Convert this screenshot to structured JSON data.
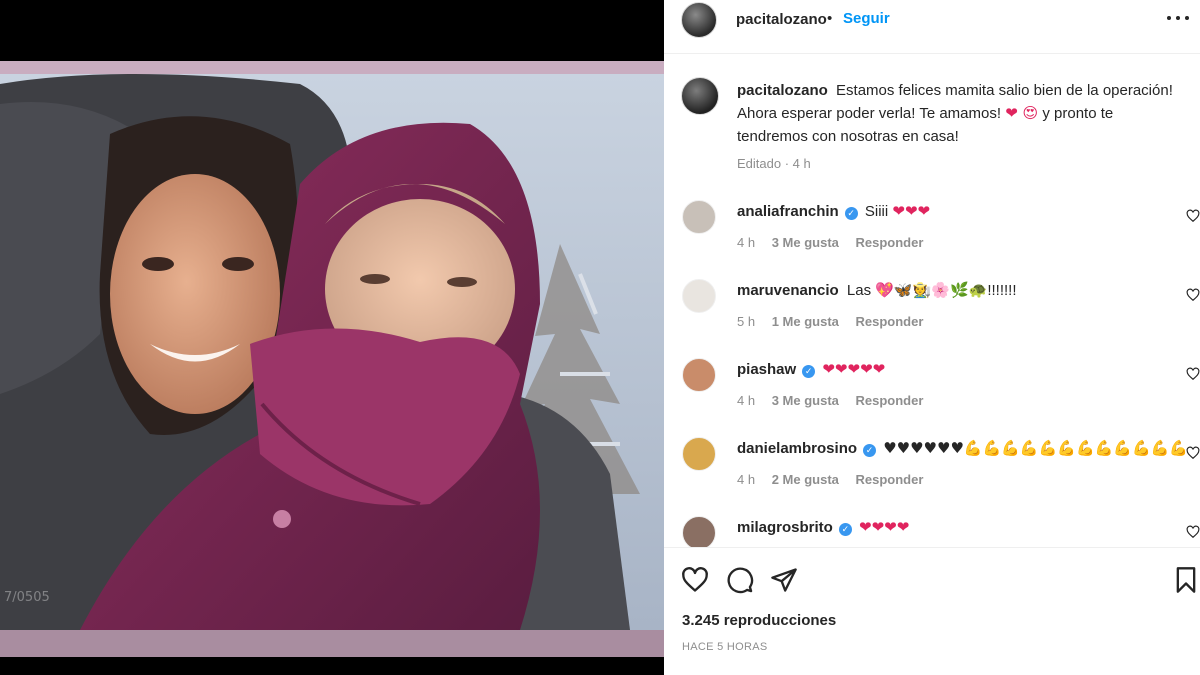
{
  "media": {
    "watermark": "7/0505"
  },
  "header": {
    "username": "pacitalozano",
    "separator": "•",
    "follow_label": "Seguir"
  },
  "caption": {
    "username": "pacitalozano",
    "text_before_emoji": "Estamos felices mamita salio bien de la operación! Ahora esperar poder verla! Te amamos!",
    "emoji": "❤ 😍",
    "text_after_emoji": "y pronto te tendremos con nosotras en casa!",
    "meta": "Editado · 4 h"
  },
  "comments": [
    {
      "username": "analiafranchin",
      "verified": true,
      "text": "Siiii",
      "emoji": "❤❤❤",
      "time": "4 h",
      "likes": "3 Me gusta",
      "reply": "Responder",
      "avatar_color": "#c8c0b8"
    },
    {
      "username": "maruvenancio",
      "verified": false,
      "text": "Las",
      "emoji": "💖🦋🧑‍🌾🌸🌿🐢",
      "text_after": "!!!!!!!",
      "time": "5 h",
      "likes": "1 Me gusta",
      "reply": "Responder",
      "avatar_color": "#e9e5e0"
    },
    {
      "username": "piashaw",
      "verified": true,
      "text": "",
      "emoji": "❤❤❤❤❤",
      "time": "4 h",
      "likes": "3 Me gusta",
      "reply": "Responder",
      "avatar_color": "#c98c6a"
    },
    {
      "username": "danielambrosino",
      "verified": true,
      "text": "",
      "emoji_black": "♥♥♥♥♥♥",
      "emoji_gold": "💪💪💪💪💪💪💪💪💪💪💪💪",
      "time": "4 h",
      "likes": "2 Me gusta",
      "reply": "Responder",
      "avatar_color": "#d9a84e"
    },
    {
      "username": "milagrosbrito",
      "verified": true,
      "text": "",
      "emoji": "❤❤❤❤",
      "avatar_color": "#8a6f63"
    }
  ],
  "actions": {
    "views": "3.245 reproducciones",
    "posted": "HACE 5 HORAS"
  },
  "colors": {
    "link_blue": "#0095f6",
    "verified_blue": "#3897f0",
    "heart_red": "#e0245e",
    "muted_gray": "#8e8e8e"
  },
  "icons": [
    "more-options-icon",
    "like-heart-icon",
    "comment-icon",
    "share-icon",
    "save-bookmark-icon",
    "verified-badge-icon"
  ]
}
